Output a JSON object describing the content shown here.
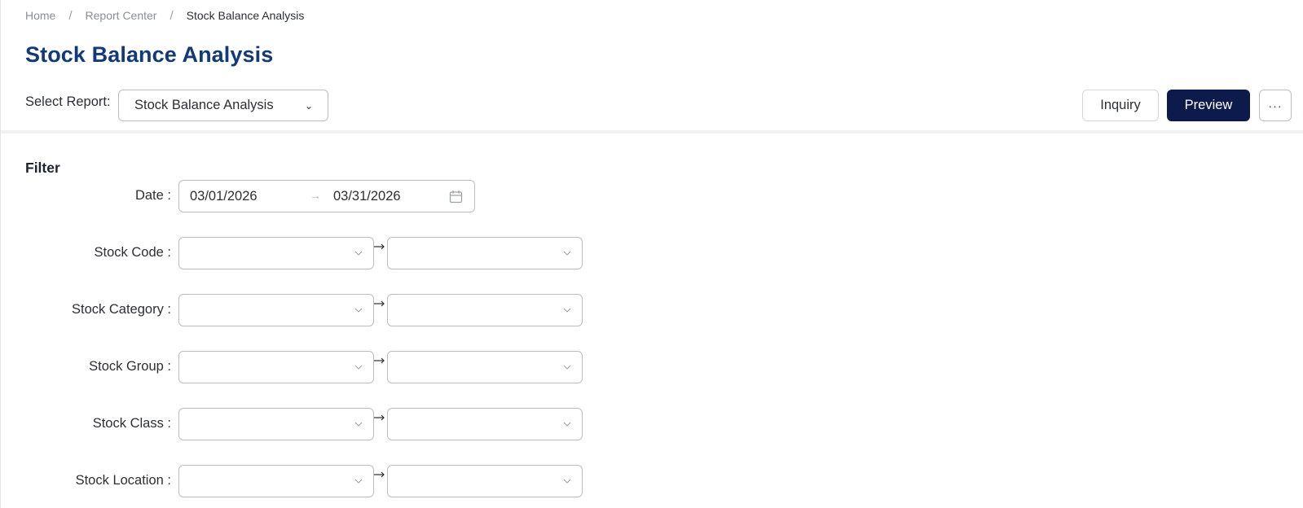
{
  "breadcrumb": {
    "items": [
      "Home",
      "Report Center",
      "Stock Balance Analysis"
    ],
    "separator": "/"
  },
  "page": {
    "title": "Stock Balance Analysis"
  },
  "toolbar": {
    "select_report_label": "Select Report:",
    "selected_report": "Stock Balance Analysis",
    "inquiry_label": "Inquiry",
    "preview_label": "Preview",
    "more_label": "···"
  },
  "filter": {
    "heading": "Filter",
    "date": {
      "label": "Date :",
      "from": "03/01/2026",
      "to": "03/31/2026"
    },
    "ranges": [
      {
        "label": "Stock Code :",
        "from": "",
        "to": ""
      },
      {
        "label": "Stock Category :",
        "from": "",
        "to": ""
      },
      {
        "label": "Stock Group :",
        "from": "",
        "to": ""
      },
      {
        "label": "Stock Class :",
        "from": "",
        "to": ""
      },
      {
        "label": "Stock Location :",
        "from": "",
        "to": ""
      }
    ]
  },
  "colors": {
    "title": "#123a78",
    "primary_button": "#0d1b4c",
    "border": "#b9bdc4"
  },
  "icons": {
    "select_chevron": "chevron-down-icon",
    "date_arrow": "arrow-right-icon",
    "calendar": "calendar-icon",
    "range_arrow": "arrow-right-icon",
    "more": "more-icon"
  }
}
